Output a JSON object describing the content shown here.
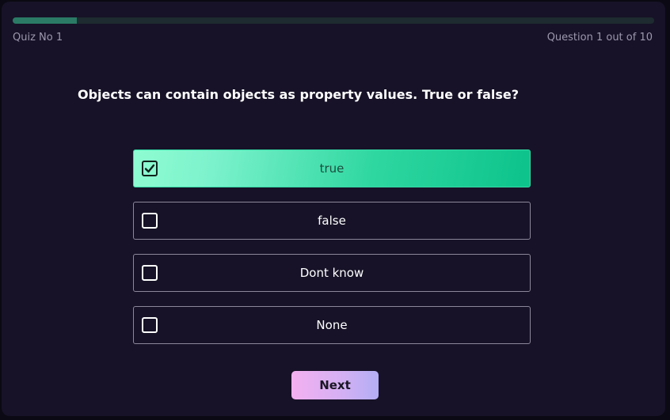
{
  "header": {
    "quiz_label": "Quiz No 1",
    "question_count": "Question 1 out of 10",
    "progress": 0.1
  },
  "question": {
    "text": "Objects can contain objects as property values. True or false?"
  },
  "options": [
    {
      "label": "true",
      "selected": true
    },
    {
      "label": "false",
      "selected": false
    },
    {
      "label": "Dont know",
      "selected": false
    },
    {
      "label": "None",
      "selected": false
    }
  ],
  "actions": {
    "next_label": "Next"
  },
  "colors": {
    "background": "#171227",
    "selected_option": "#2fd7a0",
    "progress_track": "#1e2b30",
    "next_button": "#d6b0f3"
  }
}
